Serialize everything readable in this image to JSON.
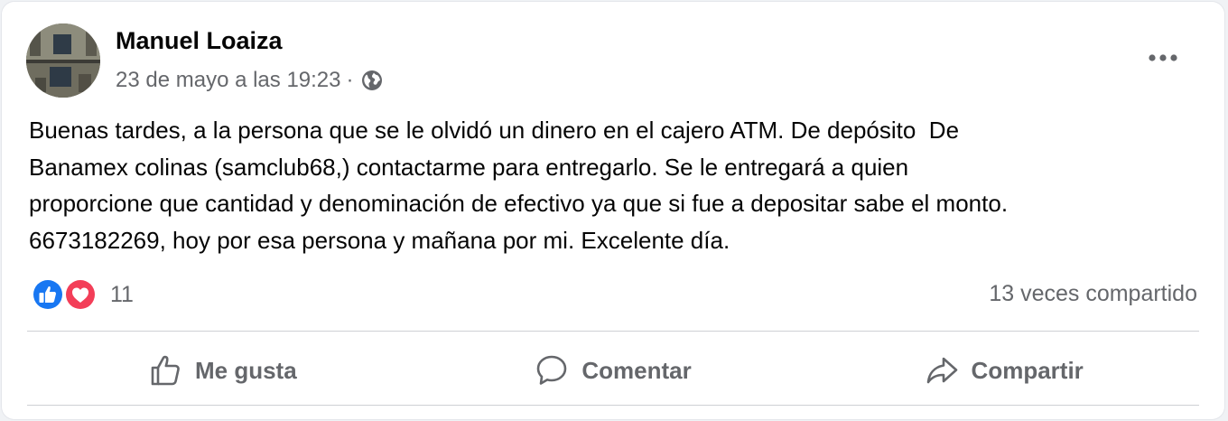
{
  "post": {
    "author": "Manuel Loaiza",
    "timestamp": "23 de mayo a las 19:23",
    "separator": "·",
    "audience_icon": "globe-icon",
    "body_lines": [
      "Buenas tardes, a la persona que se le olvidó un dinero en el cajero ATM. De depósito  De",
      "Banamex colinas (samclub68,) contactarme para entregarlo. Se le entregará a quien",
      "proporcione que cantidad y denominación de efectivo ya que si fue a depositar sabe el monto.",
      "6673182269, hoy por esa persona y mañana por mi. Excelente día."
    ]
  },
  "reactions": {
    "icons": [
      "like-reaction-icon",
      "love-reaction-icon"
    ],
    "count": "11",
    "shares": "13 veces compartido"
  },
  "actions": {
    "like_label": "Me gusta",
    "comment_label": "Comentar",
    "share_label": "Compartir"
  },
  "colors": {
    "like_blue": "#1877f2",
    "love_red": "#f33e58",
    "secondary_text": "#65676b",
    "primary_text": "#050505"
  }
}
